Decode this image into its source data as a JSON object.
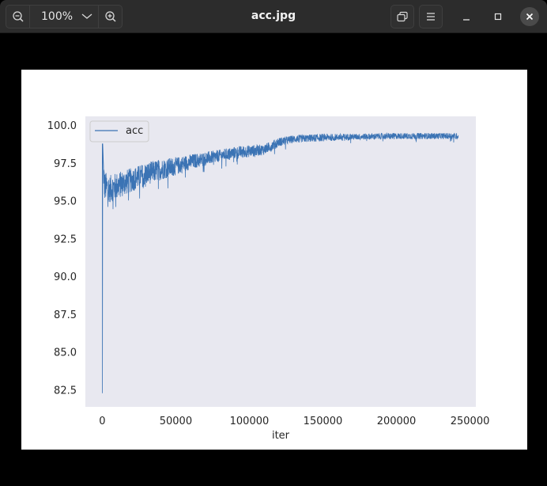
{
  "window": {
    "title": "acc.jpg",
    "zoom_level": "100%"
  },
  "icons": {
    "zoom_out": "zoom-out-icon",
    "zoom_menu": "chevron-down-icon",
    "zoom_in": "zoom-in-icon",
    "copy": "copy-icon",
    "menu": "hamburger-menu-icon",
    "minimize": "minimize-icon",
    "maximize": "maximize-icon",
    "close": "close-icon"
  },
  "colors": {
    "plot_bg": "#e8e8f0",
    "line": "#3b73b4",
    "titlebar": "#2c2c2c"
  },
  "chart_data": {
    "type": "line",
    "xlabel": "iter",
    "ylabel": "",
    "xlim": [
      -11500,
      254000
    ],
    "ylim": [
      81.4,
      100.6
    ],
    "x_ticks": [
      0,
      50000,
      100000,
      150000,
      200000,
      250000
    ],
    "x_tick_labels": [
      "0",
      "50000",
      "100000",
      "150000",
      "200000",
      "250000"
    ],
    "y_ticks": [
      82.5,
      85.0,
      87.5,
      90.0,
      92.5,
      95.0,
      97.5,
      100.0
    ],
    "y_tick_labels": [
      "82.5",
      "85.0",
      "87.5",
      "90.0",
      "92.5",
      "95.0",
      "97.5",
      "100.0"
    ],
    "grid": false,
    "legend_position": "upper-left",
    "series": [
      {
        "name": "acc",
        "x_range": [
          0,
          242000
        ],
        "x": [
          0,
          300,
          800,
          1500,
          5000,
          10000,
          20000,
          30000,
          40000,
          50000,
          60000,
          70000,
          80000,
          90000,
          100000,
          110000,
          120000,
          130000,
          140000,
          150000,
          170000,
          200000,
          220000,
          242000
        ],
        "y": [
          82.3,
          98.8,
          97.0,
          96.0,
          95.8,
          96.0,
          96.4,
          96.8,
          97.1,
          97.3,
          97.6,
          97.8,
          98.0,
          98.2,
          98.3,
          98.4,
          98.9,
          99.1,
          99.15,
          99.2,
          99.25,
          99.3,
          99.3,
          99.3
        ],
        "noise_band": [
          0.2,
          0.9,
          1.0,
          1.0,
          0.9,
          0.9,
          0.8,
          0.75,
          0.7,
          0.6,
          0.5,
          0.45,
          0.4,
          0.4,
          0.4,
          0.35,
          0.3,
          0.25,
          0.25,
          0.25,
          0.2,
          0.2,
          0.2,
          0.2
        ]
      }
    ]
  }
}
